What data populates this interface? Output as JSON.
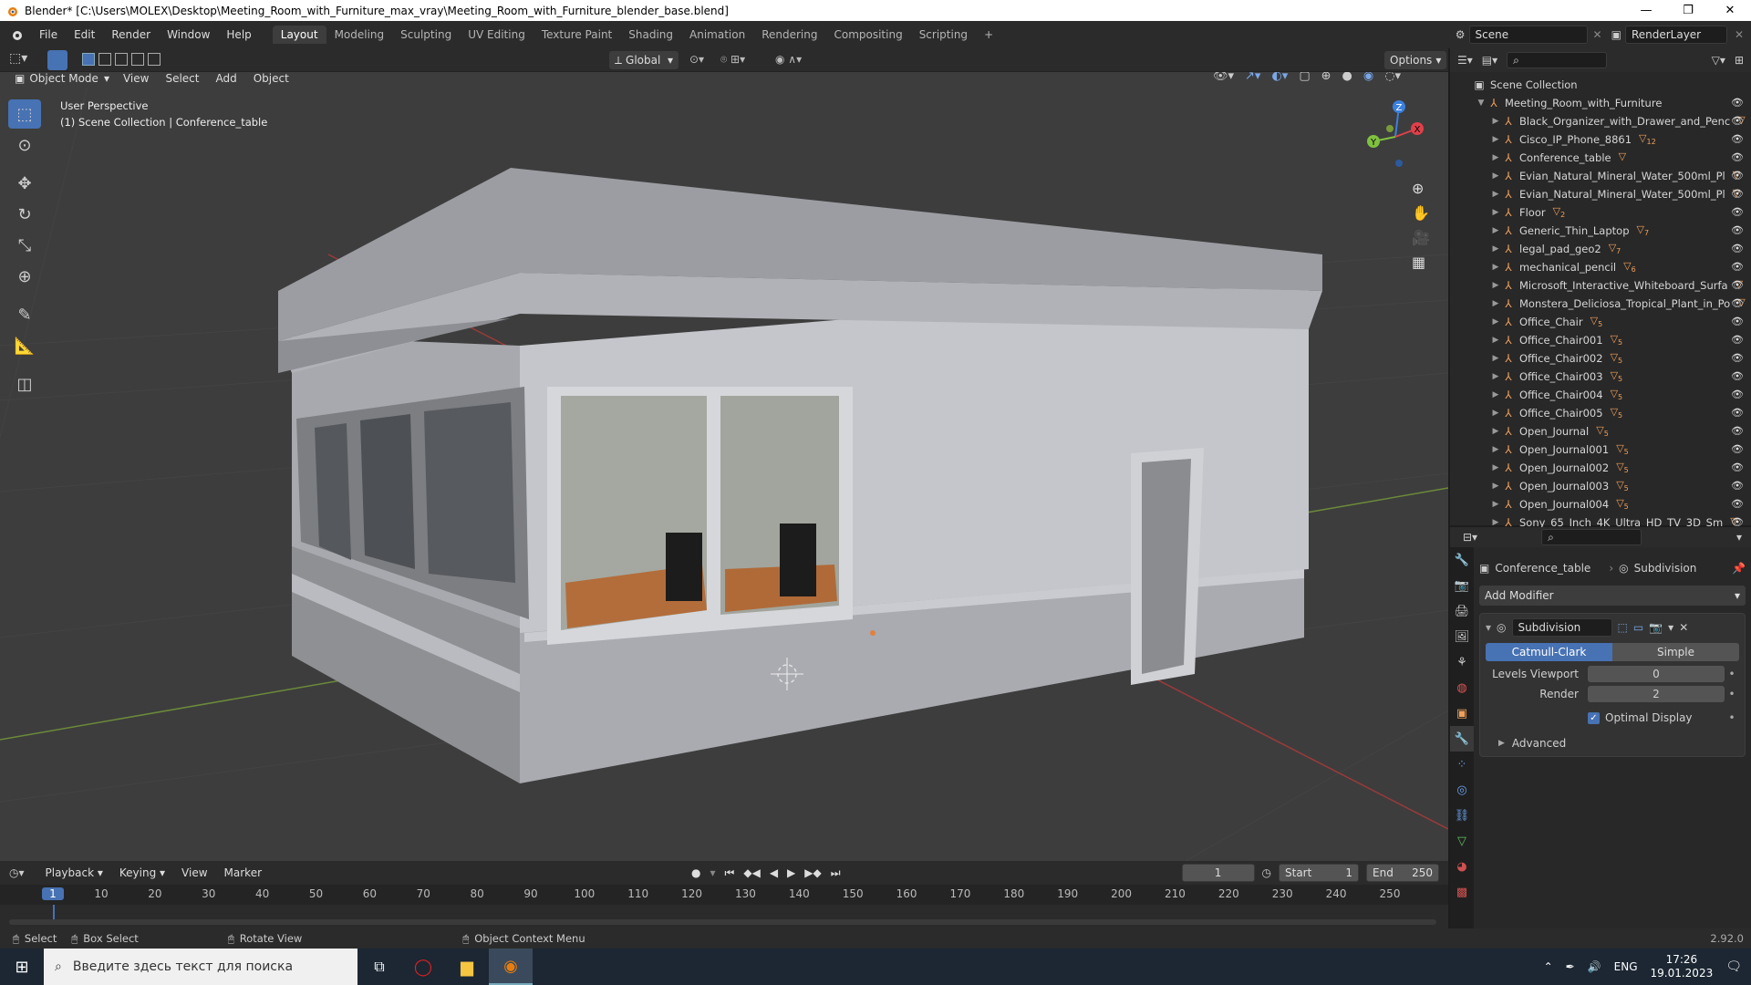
{
  "window": {
    "title": "Blender* [C:\\Users\\MOLEX\\Desktop\\Meeting_Room_with_Furniture_max_vray\\Meeting_Room_with_Furniture_blender_base.blend]",
    "minimize": "—",
    "maximize": "❐",
    "close": "✕"
  },
  "menu": [
    "File",
    "Edit",
    "Render",
    "Window",
    "Help"
  ],
  "workspaces": [
    "Layout",
    "Modeling",
    "Sculpting",
    "UV Editing",
    "Texture Paint",
    "Shading",
    "Animation",
    "Rendering",
    "Compositing",
    "Scripting"
  ],
  "workspace_add": "+",
  "scene": {
    "name": "Scene",
    "render_layer": "RenderLayer"
  },
  "viewport": {
    "mode": "Object Mode",
    "menus": [
      "View",
      "Select",
      "Add",
      "Object"
    ],
    "transform_orientation": "Global",
    "options": "Options",
    "overlay_line1": "User Perspective",
    "overlay_line2": "(1) Scene Collection | Conference_table",
    "gizmo": {
      "z": "Z",
      "y": "Y",
      "x": "X"
    }
  },
  "outliner": {
    "root": "Scene Collection",
    "collection": "Meeting_Room_with_Furniture",
    "items": [
      {
        "name": "Black_Organizer_with_Drawer_and_Penc",
        "badge": ""
      },
      {
        "name": "Cisco_IP_Phone_8861",
        "badge": "12"
      },
      {
        "name": "Conference_table",
        "badge": ""
      },
      {
        "name": "Evian_Natural_Mineral_Water_500ml_Pl",
        "badge": ""
      },
      {
        "name": "Evian_Natural_Mineral_Water_500ml_Pl",
        "badge": ""
      },
      {
        "name": "Floor",
        "badge": "2"
      },
      {
        "name": "Generic_Thin_Laptop",
        "badge": "7"
      },
      {
        "name": "legal_pad_geo2",
        "badge": "7"
      },
      {
        "name": "mechanical_pencil",
        "badge": "6"
      },
      {
        "name": "Microsoft_Interactive_Whiteboard_Surfa",
        "badge": ""
      },
      {
        "name": "Monstera_Deliciosa_Tropical_Plant_in_Po",
        "badge": ""
      },
      {
        "name": "Office_Chair",
        "badge": "5"
      },
      {
        "name": "Office_Chair001",
        "badge": "5"
      },
      {
        "name": "Office_Chair002",
        "badge": "5"
      },
      {
        "name": "Office_Chair003",
        "badge": "5"
      },
      {
        "name": "Office_Chair004",
        "badge": "5"
      },
      {
        "name": "Office_Chair005",
        "badge": "5"
      },
      {
        "name": "Open_Journal",
        "badge": "5"
      },
      {
        "name": "Open_Journal001",
        "badge": "5"
      },
      {
        "name": "Open_Journal002",
        "badge": "5"
      },
      {
        "name": "Open_Journal003",
        "badge": "5"
      },
      {
        "name": "Open_Journal004",
        "badge": "5"
      },
      {
        "name": "Sony_65_Inch_4K_Ultra_HD_TV_3D_Sm",
        "badge": ""
      }
    ]
  },
  "properties": {
    "object": "Conference_table",
    "modifier_breadcrumb": "Subdivision",
    "add_modifier": "Add Modifier",
    "modifier_name": "Subdivision",
    "mode_a": "Catmull-Clark",
    "mode_b": "Simple",
    "levels_viewport_label": "Levels Viewport",
    "levels_viewport_value": "0",
    "render_label": "Render",
    "render_value": "2",
    "optimal_display": "Optimal Display",
    "advanced": "Advanced"
  },
  "timeline": {
    "menus": [
      "Playback",
      "Keying",
      "View",
      "Marker"
    ],
    "current_frame": "1",
    "start_label": "Start",
    "start": "1",
    "end_label": "End",
    "end": "250",
    "ticks": [
      "1",
      "10",
      "20",
      "30",
      "40",
      "50",
      "60",
      "70",
      "80",
      "90",
      "100",
      "110",
      "120",
      "130",
      "140",
      "150",
      "160",
      "170",
      "180",
      "190",
      "200",
      "210",
      "220",
      "230",
      "240",
      "250"
    ]
  },
  "status": {
    "select": "Select",
    "box_select": "Box Select",
    "rotate_view": "Rotate View",
    "context_menu": "Object Context Menu",
    "version": "2.92.0"
  },
  "taskbar": {
    "search_placeholder": "Введите здесь текст для поиска",
    "lang": "ENG",
    "time": "17:26",
    "date": "19.01.2023"
  },
  "colors": {
    "accent": "#4772b3",
    "object_orange": "#f0a05a",
    "axis_x": "#e0404a",
    "axis_y": "#80c040",
    "axis_z": "#3a80e0"
  }
}
